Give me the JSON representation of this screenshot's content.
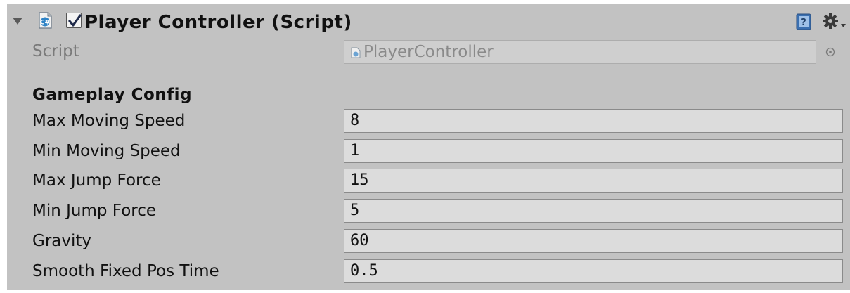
{
  "component": {
    "title": "Player Controller (Script)",
    "enabled": true
  },
  "script_field": {
    "label": "Script",
    "value": "PlayerController"
  },
  "section": {
    "header": "Gameplay Config"
  },
  "fields": [
    {
      "label": "Max Moving Speed",
      "value": "8"
    },
    {
      "label": "Min Moving Speed",
      "value": "1"
    },
    {
      "label": "Max Jump Force",
      "value": "15"
    },
    {
      "label": "Min Jump Force",
      "value": "5"
    },
    {
      "label": "Gravity",
      "value": "60"
    },
    {
      "label": "Smooth Fixed Pos Time",
      "value": "0.5"
    }
  ],
  "icons": {
    "foldout": "foldout-arrow-icon",
    "script": "csharp-script-icon",
    "help": "help-book-icon",
    "settings": "gear-icon",
    "picker": "object-picker-icon"
  },
  "colors": {
    "panel_bg": "#c2c2c2",
    "field_bg": "#dcdcdc",
    "label_dim": "#7a7a7a"
  }
}
